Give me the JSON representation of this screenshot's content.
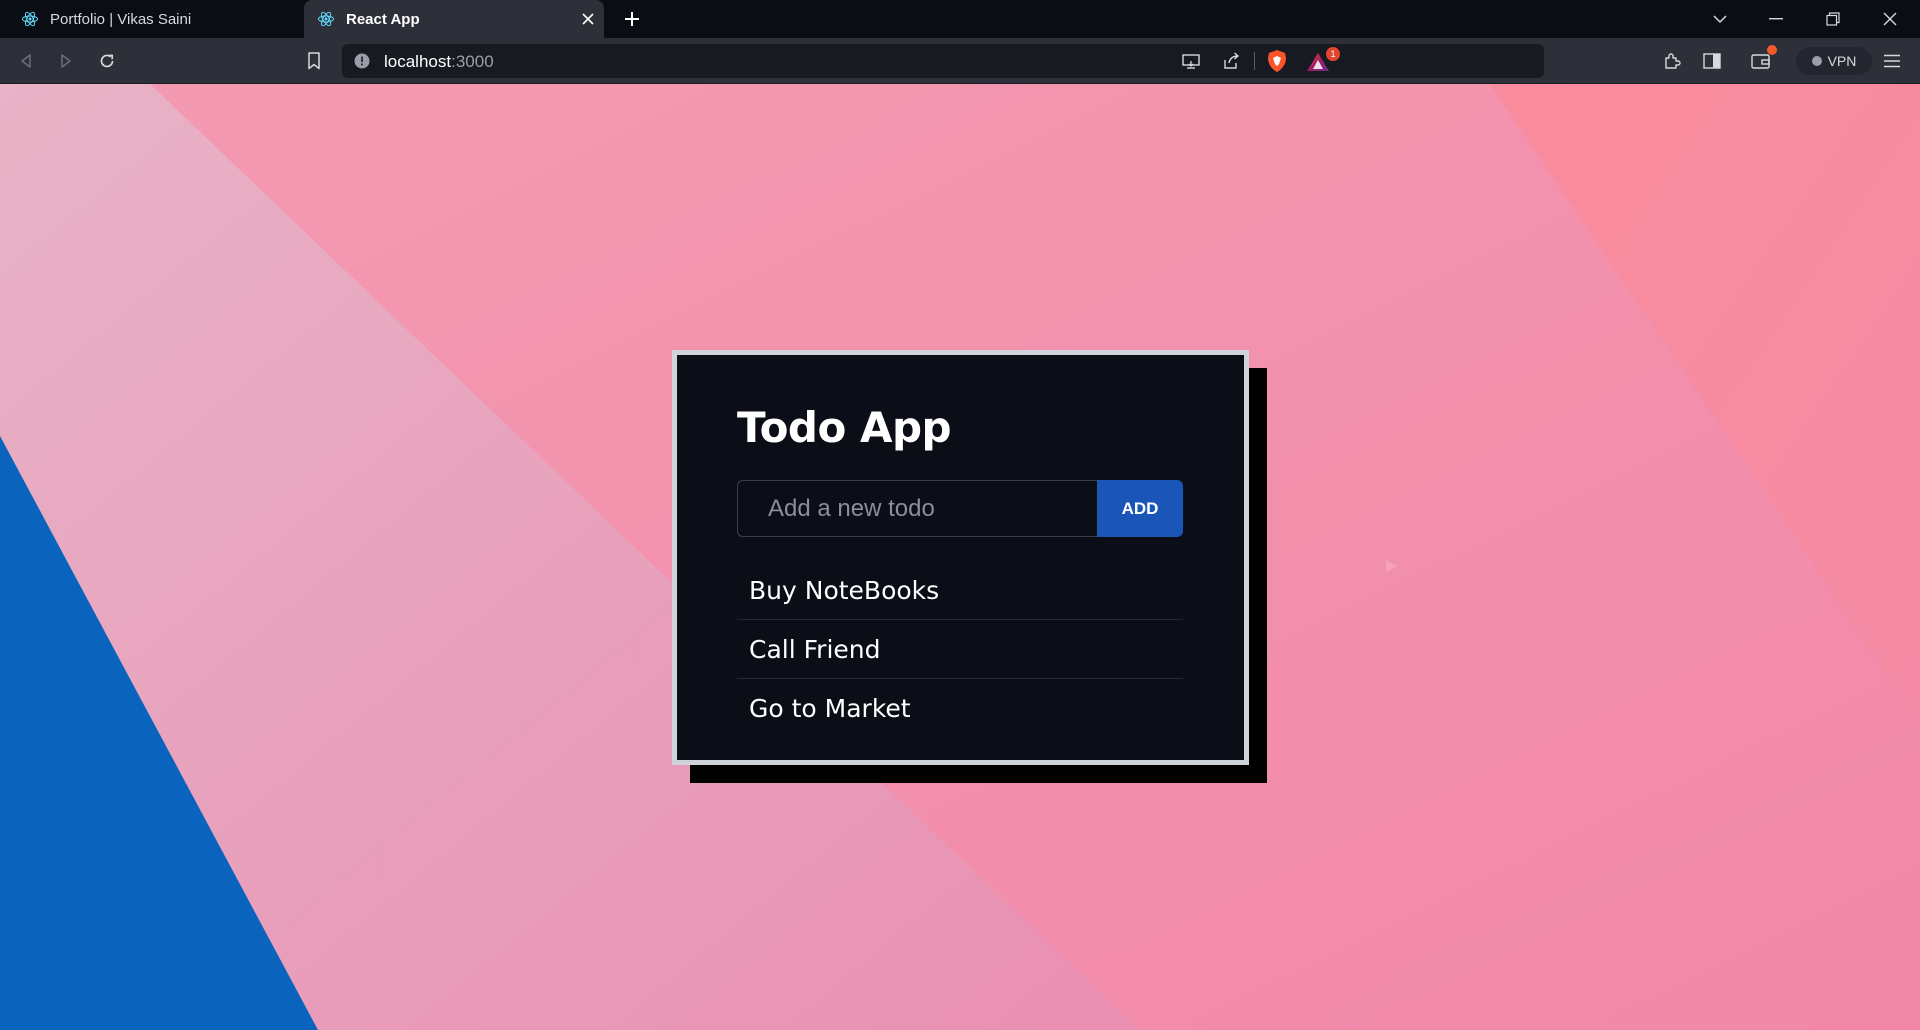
{
  "browser": {
    "tabs": [
      {
        "title": "Portfolio | Vikas Saini",
        "active": false,
        "favicon": "react-icon"
      },
      {
        "title": "React App",
        "active": true,
        "favicon": "react-icon"
      }
    ],
    "url": {
      "host": "localhost",
      "port": ":3000"
    },
    "rewards_badge": "1",
    "vpn_label": "VPN"
  },
  "app": {
    "title": "Todo App",
    "input": {
      "placeholder": "Add a new todo",
      "value": ""
    },
    "add_label": "ADD",
    "todos": [
      {
        "text": "Buy NoteBooks"
      },
      {
        "text": "Call Friend"
      },
      {
        "text": "Go to Market"
      }
    ]
  },
  "colors": {
    "background_pink": "#f295ae",
    "background_blue": "#0a63bd",
    "card": "#0b0e16",
    "card_border": "#cfd3da",
    "add_button": "#1a56b8"
  }
}
